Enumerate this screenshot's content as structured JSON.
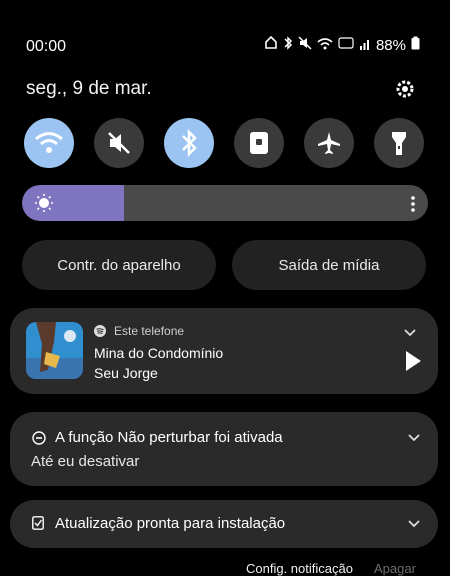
{
  "status_bar": {
    "time": "00:00",
    "battery": "88%"
  },
  "header": {
    "date": "seg., 9 de mar."
  },
  "quick_tiles": [
    {
      "name": "wifi",
      "state": "on"
    },
    {
      "name": "mute",
      "state": "off"
    },
    {
      "name": "bluetooth",
      "state": "on"
    },
    {
      "name": "screen-lock",
      "state": "off"
    },
    {
      "name": "airplane",
      "state": "off"
    },
    {
      "name": "flashlight",
      "state": "off"
    }
  ],
  "brightness": {
    "level": 0.25
  },
  "buttons": {
    "device_control": "Contr. do aparelho",
    "media_output": "Saída de mídia"
  },
  "media": {
    "source": "Este telefone",
    "title": "Mina do Condomínio",
    "artist": "Seu Jorge"
  },
  "notifications": [
    {
      "title": "A função Não perturbar foi ativada",
      "subtitle": "Até eu desativar"
    },
    {
      "title": "Atualização pronta para instalação"
    }
  ],
  "footer": {
    "settings": "Config. notificação",
    "clear": "Apagar"
  },
  "colors": {
    "tile_on": "#9cc4f2",
    "tile_off": "#3a3a3a",
    "brightness_fill": "#7e74bf"
  }
}
